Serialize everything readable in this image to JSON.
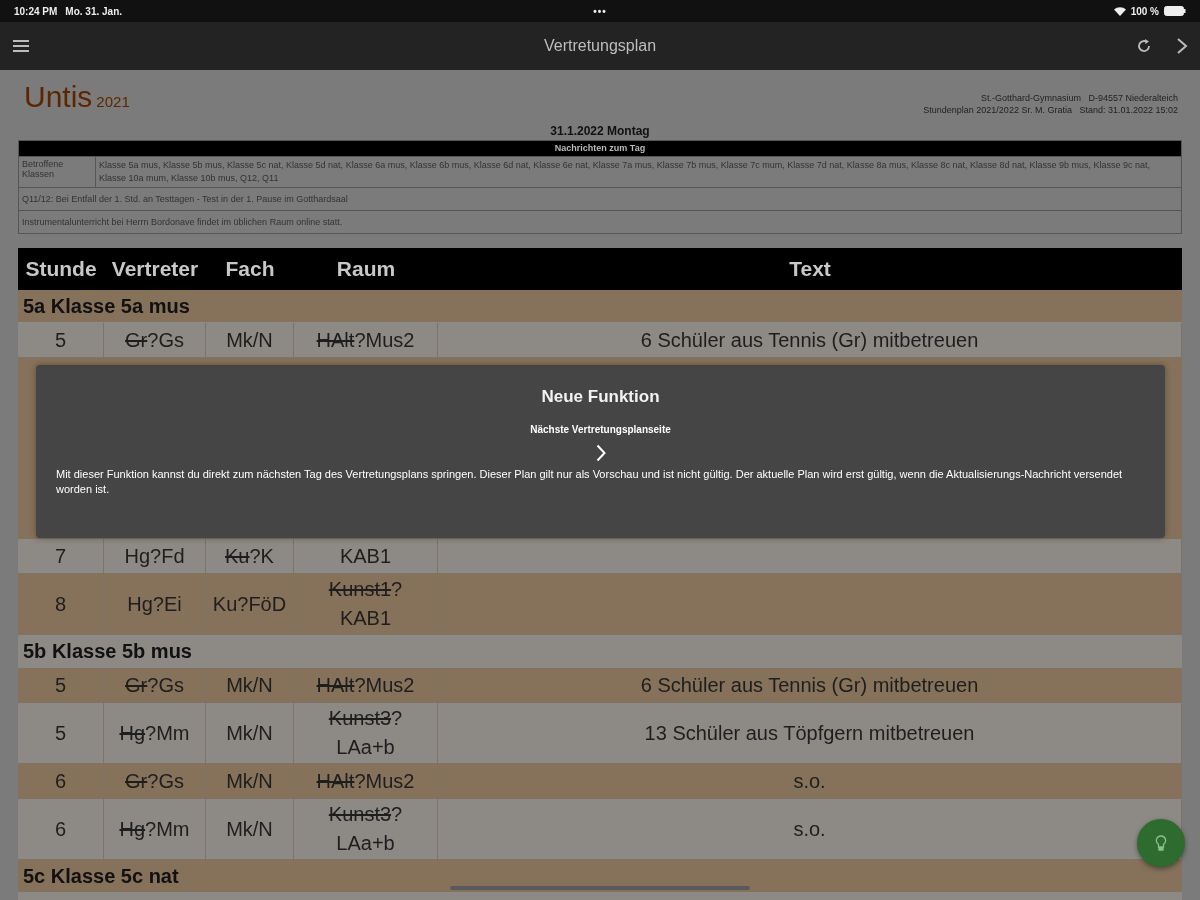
{
  "status_bar": {
    "time": "10:24 PM",
    "date": "Mo. 31. Jan.",
    "dots": "•••",
    "battery": "100 %"
  },
  "nav_bar": {
    "title": "Vertretungsplan"
  },
  "header": {
    "logo": "Untis",
    "year": "2021",
    "school": "St.-Gotthard-Gymnasium   D-94557 Niederalteich",
    "plan": "Stundenplan 2021/2022 Sr. M. Gratia   Stand: 31.01.2022 15:02"
  },
  "date_title": "31.1.2022 Montag",
  "news": {
    "title": "Nachrichten zum Tag",
    "label": "Betroffene Klassen",
    "classes": "Klasse 5a mus, Klasse 5b mus, Klasse 5c nat, Klasse 5d nat, Klasse 6a mus, Klasse 6b mus, Klasse 6d nat, Klasse 6e nat, Klasse 7a mus, Klasse 7b mus, Klasse 7c mum, Klasse 7d nat, Klasse 8a mus, Klasse 8c nat, Klasse 8d nat, Klasse 9b mus, Klasse 9c nat, Klasse 10a mum, Klasse 10b mus, Q12, Q11",
    "messages": [
      "Q11/12: Bei Entfall der 1. Std. an Testtagen - Test in der 1. Pause im Gotthardsaal",
      "Instrumentalunterricht bei Herrn Bordonave findet im üblichen Raum online statt."
    ]
  },
  "table": {
    "columns": [
      "Stunde",
      "Vertreter",
      "Fach",
      "Raum",
      "Text"
    ],
    "rows": [
      {
        "kind": "group",
        "label": "5a Klasse 5a mus",
        "shaded": true
      },
      {
        "kind": "entry",
        "shaded": false,
        "cells": [
          [
            {
              "text": "5"
            }
          ],
          [
            {
              "struck": "Gr",
              "text": "?Gs"
            }
          ],
          [
            {
              "text": "Mk/N"
            }
          ],
          [
            {
              "struck": "HAlt",
              "text": "?Mus2"
            }
          ],
          [
            {
              "text": "6 Schüler aus Tennis (Gr) mitbetreuen"
            }
          ]
        ]
      },
      {
        "kind": "covered",
        "shaded": true
      },
      {
        "kind": "entry",
        "shaded": false,
        "cells": [
          [
            {
              "text": "7"
            }
          ],
          [
            {
              "text": "Hg?Fd"
            }
          ],
          [
            {
              "struck": "Ku",
              "text": "?K"
            }
          ],
          [
            {
              "text": "KAB1"
            }
          ],
          []
        ]
      },
      {
        "kind": "entry",
        "shaded": true,
        "cells": [
          [
            {
              "text": "8"
            }
          ],
          [
            {
              "text": "Hg?Ei"
            }
          ],
          [
            {
              "text": "Ku?FöD"
            }
          ],
          [
            {
              "struck": "Kunst1",
              "text": "?"
            },
            {
              "text": "KAB1"
            }
          ],
          []
        ]
      },
      {
        "kind": "group",
        "label": "5b Klasse 5b mus",
        "shaded": false
      },
      {
        "kind": "entry",
        "shaded": true,
        "cells": [
          [
            {
              "text": "5"
            }
          ],
          [
            {
              "struck": "Gr",
              "text": "?Gs"
            }
          ],
          [
            {
              "text": "Mk/N"
            }
          ],
          [
            {
              "struck": "HAlt",
              "text": "?Mus2"
            }
          ],
          [
            {
              "text": "6 Schüler aus Tennis (Gr) mitbetreuen"
            }
          ]
        ]
      },
      {
        "kind": "entry",
        "shaded": false,
        "cells": [
          [
            {
              "text": "5"
            }
          ],
          [
            {
              "struck": "Hg",
              "text": "?Mm"
            }
          ],
          [
            {
              "text": "Mk/N"
            }
          ],
          [
            {
              "struck": "Kunst3",
              "text": "?"
            },
            {
              "text": "LAa+b"
            }
          ],
          [
            {
              "text": "13 Schüler aus Töpfgern mitbetreuen"
            }
          ]
        ]
      },
      {
        "kind": "entry",
        "shaded": true,
        "cells": [
          [
            {
              "text": "6"
            }
          ],
          [
            {
              "struck": "Gr",
              "text": "?Gs"
            }
          ],
          [
            {
              "text": "Mk/N"
            }
          ],
          [
            {
              "struck": "HAlt",
              "text": "?Mus2"
            }
          ],
          [
            {
              "text": "s.o."
            }
          ]
        ]
      },
      {
        "kind": "entry",
        "shaded": false,
        "cells": [
          [
            {
              "text": "6"
            }
          ],
          [
            {
              "struck": "Hg",
              "text": "?Mm"
            }
          ],
          [
            {
              "text": "Mk/N"
            }
          ],
          [
            {
              "struck": "Kunst3",
              "text": "?"
            },
            {
              "text": "LAa+b"
            }
          ],
          [
            {
              "text": "s.o."
            }
          ]
        ]
      },
      {
        "kind": "group",
        "label": "5c Klasse 5c nat",
        "shaded": true
      },
      {
        "kind": "cut",
        "shaded": false
      }
    ]
  },
  "dialog": {
    "title": "Neue Funktion",
    "subtitle": "Nächste Vertretungsplanseite",
    "body": "Mit dieser Funktion kannst du direkt zum nächsten Tag des Vertretungsplans springen. Dieser Plan gilt nur als Vorschau und ist nicht gültig. Der aktuelle Plan wird erst gültig, wenn die Aktualisierungs-Nachricht versendet worden ist."
  }
}
